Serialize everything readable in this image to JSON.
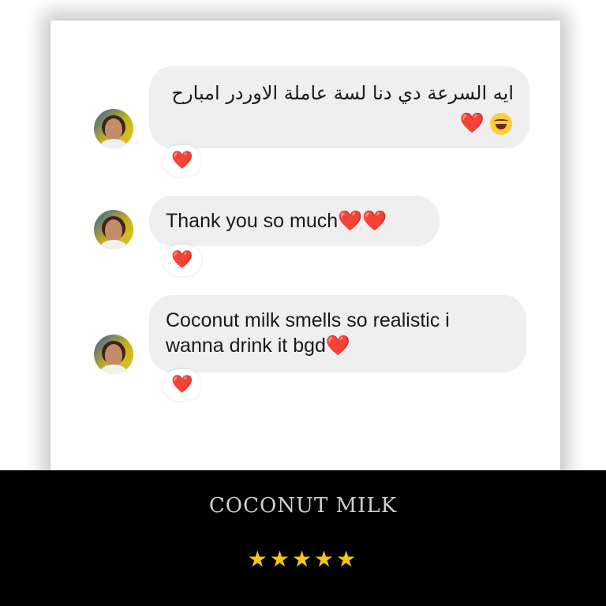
{
  "messages": [
    {
      "line1": "ايه السرعة دي دنا لسة عاملة الاوردر امبارح",
      "emoji_line": "❤️",
      "laugh_icon": "joy-emoji-icon",
      "reaction": "❤️"
    },
    {
      "text": "Thank you so much",
      "text_emoji": "❤️❤️",
      "reaction": "❤️"
    },
    {
      "line1": "Coconut milk smells so realistic i",
      "line2": "wanna drink it bgd",
      "text_emoji": "❤️",
      "reaction": "❤️"
    }
  ],
  "product": {
    "title": "COCONUT MILK",
    "rating_stars": "★★★★★",
    "rating": 5
  },
  "colors": {
    "bubble": "#efefef",
    "heart": "#e4182a",
    "footer_bg": "#000000",
    "star": "#f5c518"
  }
}
